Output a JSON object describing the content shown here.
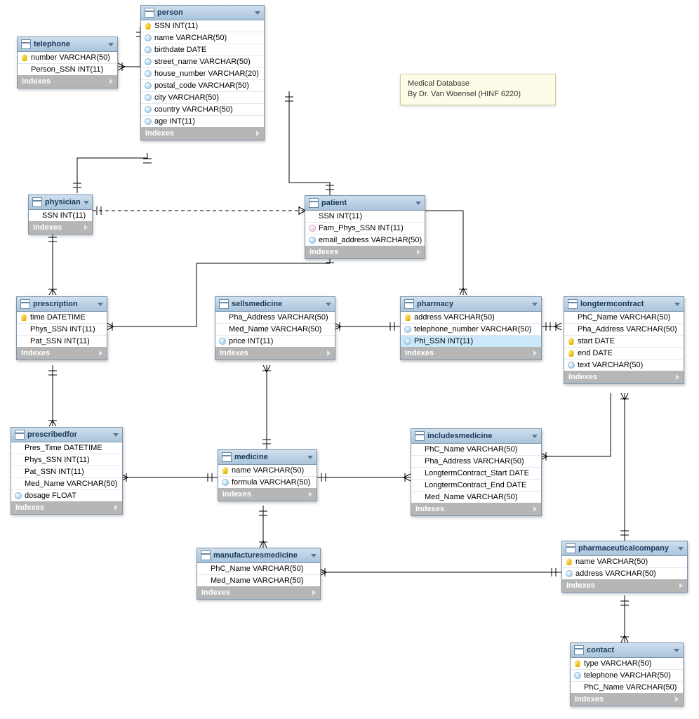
{
  "indexes_label": "Indexes",
  "note": {
    "line1": "Medical Database",
    "line2": "By Dr. Van Woensel (HINF 6220)"
  },
  "entities": {
    "telephone": {
      "name": "telephone",
      "columns": [
        {
          "icon": "pk",
          "label": "number VARCHAR(50)"
        },
        {
          "icon": "blank",
          "label": "Person_SSN INT(11)"
        }
      ]
    },
    "person": {
      "name": "person",
      "columns": [
        {
          "icon": "pk",
          "label": "SSN INT(11)"
        },
        {
          "icon": "attr",
          "label": "name VARCHAR(50)"
        },
        {
          "icon": "attr",
          "label": "birthdate DATE"
        },
        {
          "icon": "attr",
          "label": "street_name VARCHAR(50)"
        },
        {
          "icon": "attr",
          "label": "house_number VARCHAR(20)"
        },
        {
          "icon": "attr",
          "label": "postal_code VARCHAR(50)"
        },
        {
          "icon": "attr",
          "label": "city VARCHAR(50)"
        },
        {
          "icon": "attr",
          "label": "country VARCHAR(50)"
        },
        {
          "icon": "attr",
          "label": "age INT(11)"
        }
      ]
    },
    "physician": {
      "name": "physician",
      "columns": [
        {
          "icon": "blank",
          "label": "SSN INT(11)"
        }
      ]
    },
    "patient": {
      "name": "patient",
      "columns": [
        {
          "icon": "blank",
          "label": "SSN INT(11)"
        },
        {
          "icon": "optional",
          "label": "Fam_Phys_SSN INT(11)"
        },
        {
          "icon": "attr",
          "label": "email_address VARCHAR(50)"
        }
      ]
    },
    "prescription": {
      "name": "prescription",
      "columns": [
        {
          "icon": "pk",
          "label": "time DATETIME"
        },
        {
          "icon": "blank",
          "label": "Phys_SSN INT(11)"
        },
        {
          "icon": "blank",
          "label": "Pat_SSN INT(11)"
        }
      ]
    },
    "sellsmedicine": {
      "name": "sellsmedicine",
      "columns": [
        {
          "icon": "blank",
          "label": "Pha_Address VARCHAR(50)"
        },
        {
          "icon": "blank",
          "label": "Med_Name VARCHAR(50)"
        },
        {
          "icon": "attr",
          "label": "price INT(11)"
        }
      ]
    },
    "pharmacy": {
      "name": "pharmacy",
      "columns": [
        {
          "icon": "pk",
          "label": "address VARCHAR(50)"
        },
        {
          "icon": "attr",
          "label": "telephone_number VARCHAR(50)"
        },
        {
          "icon": "attr",
          "label": "Phi_SSN INT(11)",
          "highlight": true
        }
      ]
    },
    "longtermcontract": {
      "name": "longtermcontract",
      "columns": [
        {
          "icon": "blank",
          "label": "PhC_Name VARCHAR(50)"
        },
        {
          "icon": "blank",
          "label": "Pha_Address VARCHAR(50)"
        },
        {
          "icon": "pk",
          "label": "start DATE"
        },
        {
          "icon": "pk",
          "label": "end DATE"
        },
        {
          "icon": "attr",
          "label": "text VARCHAR(50)"
        }
      ]
    },
    "prescribedfor": {
      "name": "prescribedfor",
      "columns": [
        {
          "icon": "blank",
          "label": "Pres_Time DATETIME"
        },
        {
          "icon": "blank",
          "label": "Phys_SSN INT(11)"
        },
        {
          "icon": "blank",
          "label": "Pat_SSN INT(11)"
        },
        {
          "icon": "blank",
          "label": "Med_Name VARCHAR(50)"
        },
        {
          "icon": "attr",
          "label": "dosage FLOAT"
        }
      ]
    },
    "medicine": {
      "name": "medicine",
      "columns": [
        {
          "icon": "pk",
          "label": "name VARCHAR(50)"
        },
        {
          "icon": "attr",
          "label": "formula VARCHAR(50)"
        }
      ]
    },
    "includesmedicine": {
      "name": "includesmedicine",
      "columns": [
        {
          "icon": "blank",
          "label": "PhC_Name VARCHAR(50)"
        },
        {
          "icon": "blank",
          "label": "Pha_Address VARCHAR(50)"
        },
        {
          "icon": "blank",
          "label": "LongtermContract_Start DATE"
        },
        {
          "icon": "blank",
          "label": "LongtermContract_End DATE"
        },
        {
          "icon": "blank",
          "label": "Med_Name VARCHAR(50)"
        }
      ]
    },
    "manufacturesmedicine": {
      "name": "manufacturesmedicine",
      "columns": [
        {
          "icon": "blank",
          "label": "PhC_Name VARCHAR(50)"
        },
        {
          "icon": "blank",
          "label": "Med_Name VARCHAR(50)"
        }
      ]
    },
    "pharmaceuticalcompany": {
      "name": "pharmaceuticalcompany",
      "columns": [
        {
          "icon": "pk",
          "label": "name VARCHAR(50)"
        },
        {
          "icon": "attr",
          "label": "address VARCHAR(50)"
        }
      ]
    },
    "contact": {
      "name": "contact",
      "columns": [
        {
          "icon": "pk",
          "label": "type VARCHAR(50)"
        },
        {
          "icon": "attr",
          "label": "telephone VARCHAR(50)"
        },
        {
          "icon": "blank",
          "label": "PhC_Name VARCHAR(50)"
        }
      ]
    }
  },
  "chart_data": {
    "type": "table",
    "title": "Medical Database",
    "description": "Entity-Relationship diagram for medical database by Dr. Van Woensel (HINF 6220)",
    "entities": [
      "telephone",
      "person",
      "physician",
      "patient",
      "prescription",
      "sellsmedicine",
      "pharmacy",
      "longtermcontract",
      "prescribedfor",
      "medicine",
      "includesmedicine",
      "manufacturesmedicine",
      "pharmaceuticalcompany",
      "contact"
    ],
    "relationships": [
      {
        "from": "telephone",
        "to": "person",
        "type": "many-to-one"
      },
      {
        "from": "physician",
        "to": "person",
        "type": "one-to-one"
      },
      {
        "from": "patient",
        "to": "person",
        "type": "one-to-one"
      },
      {
        "from": "patient",
        "to": "physician",
        "type": "many-to-one",
        "style": "dashed"
      },
      {
        "from": "prescription",
        "to": "physician",
        "type": "many-to-one"
      },
      {
        "from": "prescription",
        "to": "patient",
        "type": "many-to-one"
      },
      {
        "from": "prescribedfor",
        "to": "prescription",
        "type": "many-to-one"
      },
      {
        "from": "prescribedfor",
        "to": "medicine",
        "type": "many-to-one"
      },
      {
        "from": "sellsmedicine",
        "to": "medicine",
        "type": "many-to-one"
      },
      {
        "from": "sellsmedicine",
        "to": "pharmacy",
        "type": "many-to-one"
      },
      {
        "from": "pharmacy",
        "to": "physician",
        "type": "many-to-one"
      },
      {
        "from": "longtermcontract",
        "to": "pharmacy",
        "type": "many-to-one"
      },
      {
        "from": "longtermcontract",
        "to": "pharmaceuticalcompany",
        "type": "many-to-one"
      },
      {
        "from": "includesmedicine",
        "to": "longtermcontract",
        "type": "many-to-one"
      },
      {
        "from": "includesmedicine",
        "to": "medicine",
        "type": "many-to-one"
      },
      {
        "from": "manufacturesmedicine",
        "to": "medicine",
        "type": "many-to-one"
      },
      {
        "from": "manufacturesmedicine",
        "to": "pharmaceuticalcompany",
        "type": "many-to-one"
      },
      {
        "from": "contact",
        "to": "pharmaceuticalcompany",
        "type": "many-to-one"
      }
    ]
  }
}
